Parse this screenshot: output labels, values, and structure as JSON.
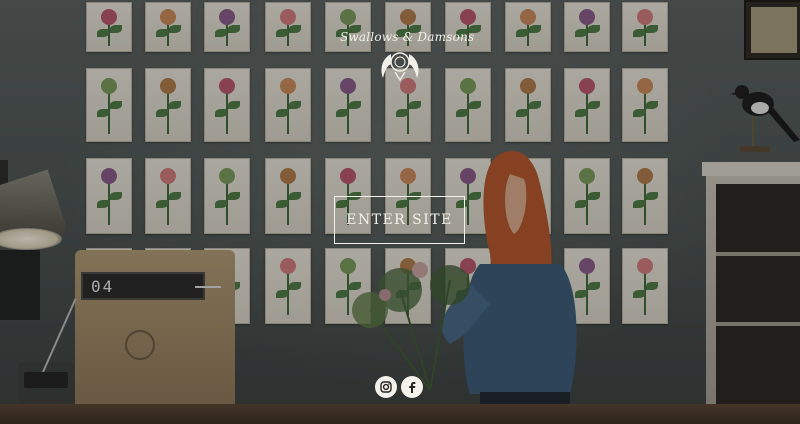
{
  "brand": {
    "name": "Swallows & Damsons"
  },
  "hero": {
    "enter_label": "ENTER SITE"
  },
  "clock": {
    "display": "04"
  },
  "social": {
    "instagram_icon": "instagram-icon",
    "facebook_icon": "facebook-icon"
  },
  "colors": {
    "overlay_text": "#f4f1ea",
    "wall": "#4d5553"
  }
}
